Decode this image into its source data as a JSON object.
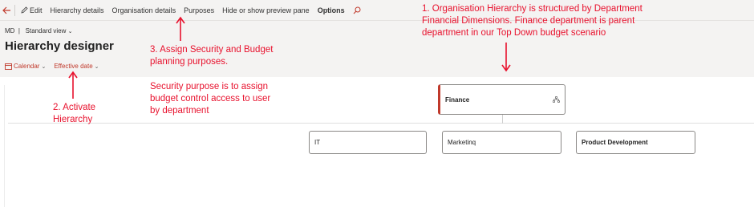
{
  "toolbar": {
    "edit": "Edit",
    "hierarchy_details": "Hierarchy details",
    "organisation_details": "Organisation details",
    "purposes": "Purposes",
    "hide_show_preview": "Hide or show preview pane",
    "options": "Options"
  },
  "header": {
    "company": "MD",
    "view": "Standard view",
    "title": "Hierarchy designer",
    "calendar": "Calendar",
    "effective_date": "Effective date"
  },
  "nodes": {
    "parent": "Finance",
    "children": [
      "IT",
      "Marketinq",
      "Product Development"
    ]
  },
  "annotations": {
    "note1_line1": "1. Organisation Hierarchy is structured by Department",
    "note1_line2": "Financial Dimensions. Finance department is parent",
    "note1_line3": "department in our Top Down budget scenario",
    "note2_line1": "2. Activate",
    "note2_line2": "Hierarchy",
    "note3_line1": "3. Assign Security and Budget",
    "note3_line2": "planning purposes.",
    "note4_line1": "Security purpose is to assign",
    "note4_line2": "budget control access to user",
    "note4_line3": "by department"
  },
  "colors": {
    "accent": "#c0392b",
    "annotation": "#e8112d",
    "toolbar_bg": "#f4f3f2"
  }
}
